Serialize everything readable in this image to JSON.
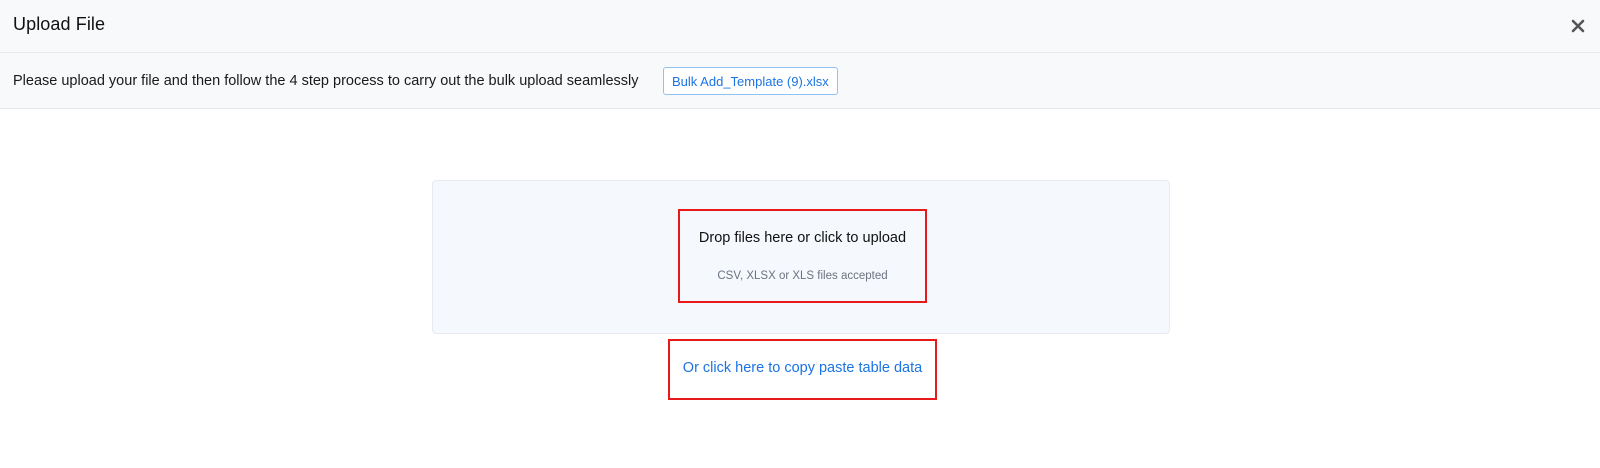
{
  "header": {
    "title": "Upload File",
    "close_icon": "close-icon"
  },
  "info": {
    "text": "Please upload your file and then follow the 4 step process to carry out the bulk upload seamlessly",
    "template_file": "Bulk Add_Template (9).xlsx"
  },
  "dropzone": {
    "title": "Drop files here or click to upload",
    "subtitle": "CSV, XLSX or XLS files accepted"
  },
  "paste": {
    "link_text": "Or click here to copy paste table data"
  },
  "colors": {
    "accent": "#1b74e4",
    "highlight": "#e8191b"
  }
}
